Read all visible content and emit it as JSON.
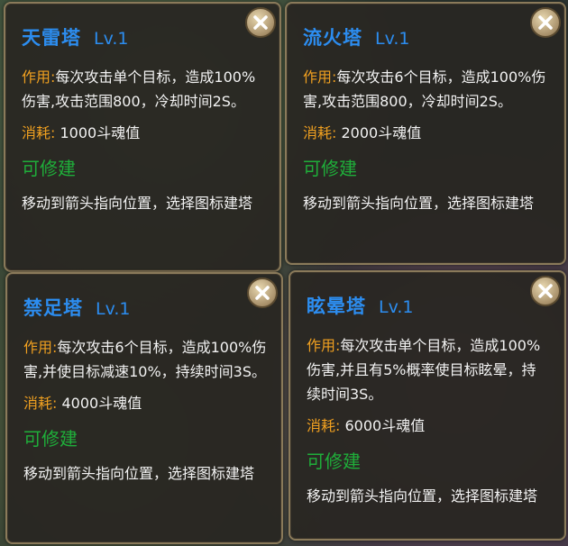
{
  "common": {
    "effect_label": "作用:",
    "cost_label": "消耗:",
    "status": "可修建",
    "hint": "移动到箭头指向位置，选择图标建塔"
  },
  "towers": [
    {
      "name": "天雷塔",
      "level": "Lv.1",
      "effect": "每次攻击单个目标，造成100%伤害,攻击范围800，冷却时间2S。",
      "cost": "1000斗魂值"
    },
    {
      "name": "流火塔",
      "level": "Lv.1",
      "effect": "每次攻击6个目标，造成100%伤害,攻击范围800，冷却时间2S。",
      "cost": "2000斗魂值"
    },
    {
      "name": "禁足塔",
      "level": "Lv.1",
      "effect": "每次攻击6个目标，造成100%伤害,并使目标减速10%，持续时间3S。",
      "cost": "4000斗魂值"
    },
    {
      "name": "眩晕塔",
      "level": "Lv.1",
      "effect": "每次攻击单个目标，造成100%伤害,并且有5%概率使目标眩晕，持续时间3S。",
      "cost": "6000斗魂值"
    }
  ]
}
